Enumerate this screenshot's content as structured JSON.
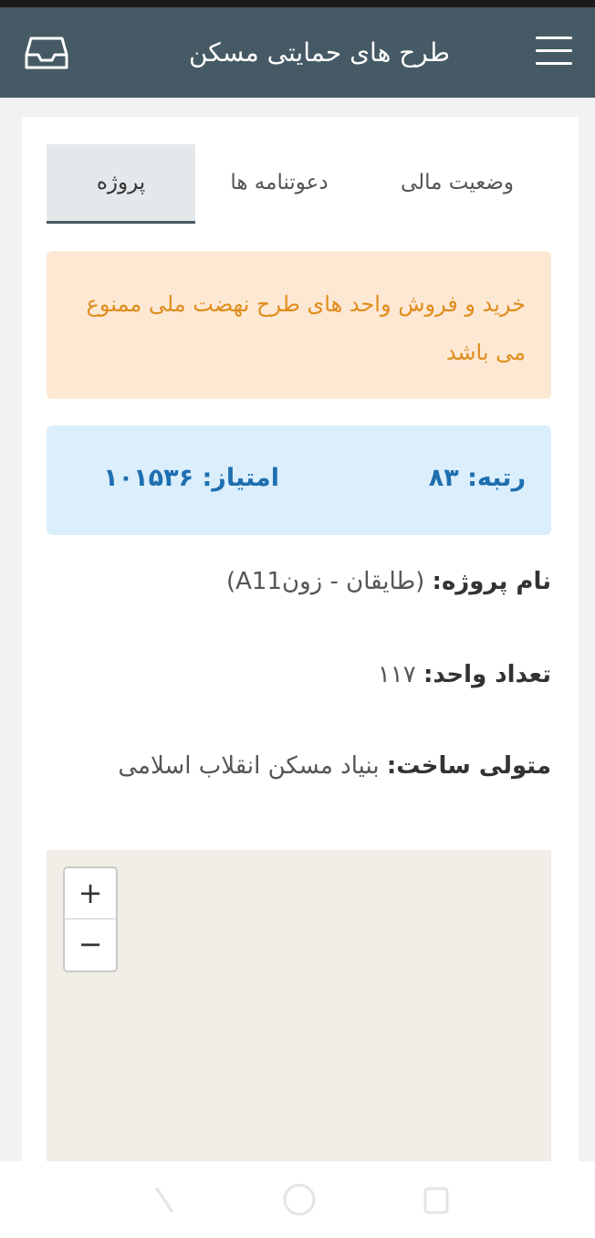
{
  "header": {
    "title": "طرح های حمایتی مسکن",
    "menu_icon": "hamburger-menu-icon",
    "inbox_icon": "inbox-tray-icon",
    "bg_color": "#455a64"
  },
  "tabs": [
    {
      "label": "وضعیت مالی",
      "active": false
    },
    {
      "label": "دعوتنامه ها",
      "active": false
    },
    {
      "label": "پروژه",
      "active": true
    }
  ],
  "warning": {
    "text": "خرید و فروش واحد های طرح نهضت ملی ممنوع می باشد",
    "color": "#e08d1c",
    "bg_color": "#fde8d4"
  },
  "stats": {
    "rank": "رتبه: ۸۳",
    "score": "امتیاز: ۱۰۱۵۳۶",
    "color": "#1e6fb0",
    "bg_color": "#dbeefc"
  },
  "project": {
    "name_label": "نام پروژه:",
    "name_value": "(طایقان - زونA11)",
    "units_label": "تعداد واحد:",
    "units_value": "۱۱۷",
    "builder_label": "متولی ساخت:",
    "builder_value": "بنیاد مسکن انقلاب اسلامی"
  },
  "map": {
    "zoom_in": "+",
    "zoom_out": "−"
  },
  "navbar": {
    "back_icon": "back-icon",
    "home_icon": "home-circle-icon",
    "recent_icon": "recent-apps-icon"
  }
}
